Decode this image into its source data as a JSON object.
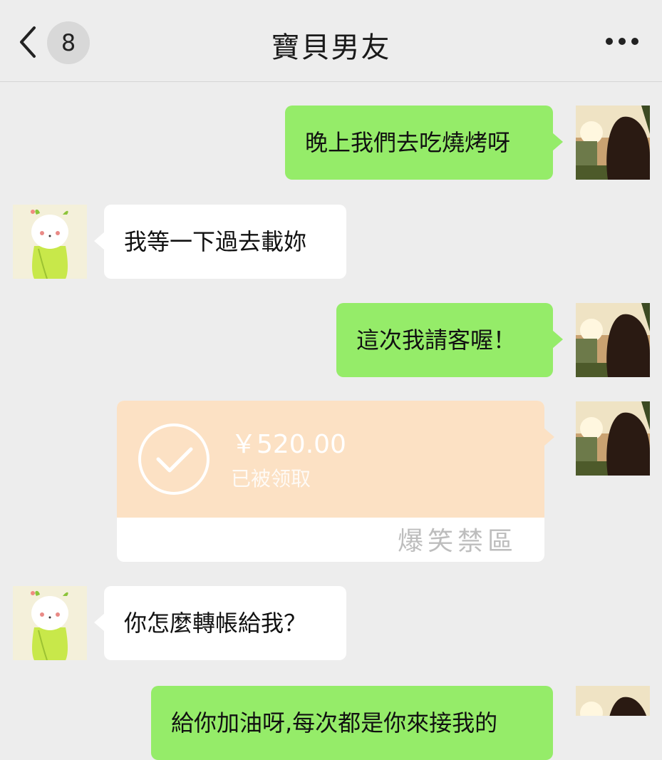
{
  "header": {
    "title": "寶貝男友",
    "unread_count": "8"
  },
  "messages": [
    {
      "sender": "me",
      "text": "晚上我們去吃燒烤呀"
    },
    {
      "sender": "other",
      "text": "我等一下過去載妳"
    },
    {
      "sender": "me",
      "text": "這次我請客喔！"
    },
    {
      "sender": "me",
      "type": "transfer",
      "amount": "￥520.00",
      "status": "已被领取"
    },
    {
      "sender": "other",
      "text": "你怎麼轉帳給我？"
    },
    {
      "sender": "me",
      "text": "給你加油呀,每次都是你來接我的"
    }
  ],
  "watermark": "爆笑禁區",
  "colors": {
    "background": "#ededed",
    "my_bubble": "#95ec69",
    "their_bubble": "#ffffff",
    "transfer_card": "#fce1c4"
  },
  "icons": {
    "back": "chevron-left-icon",
    "more": "more-dots-icon",
    "received": "check-circle-icon"
  }
}
